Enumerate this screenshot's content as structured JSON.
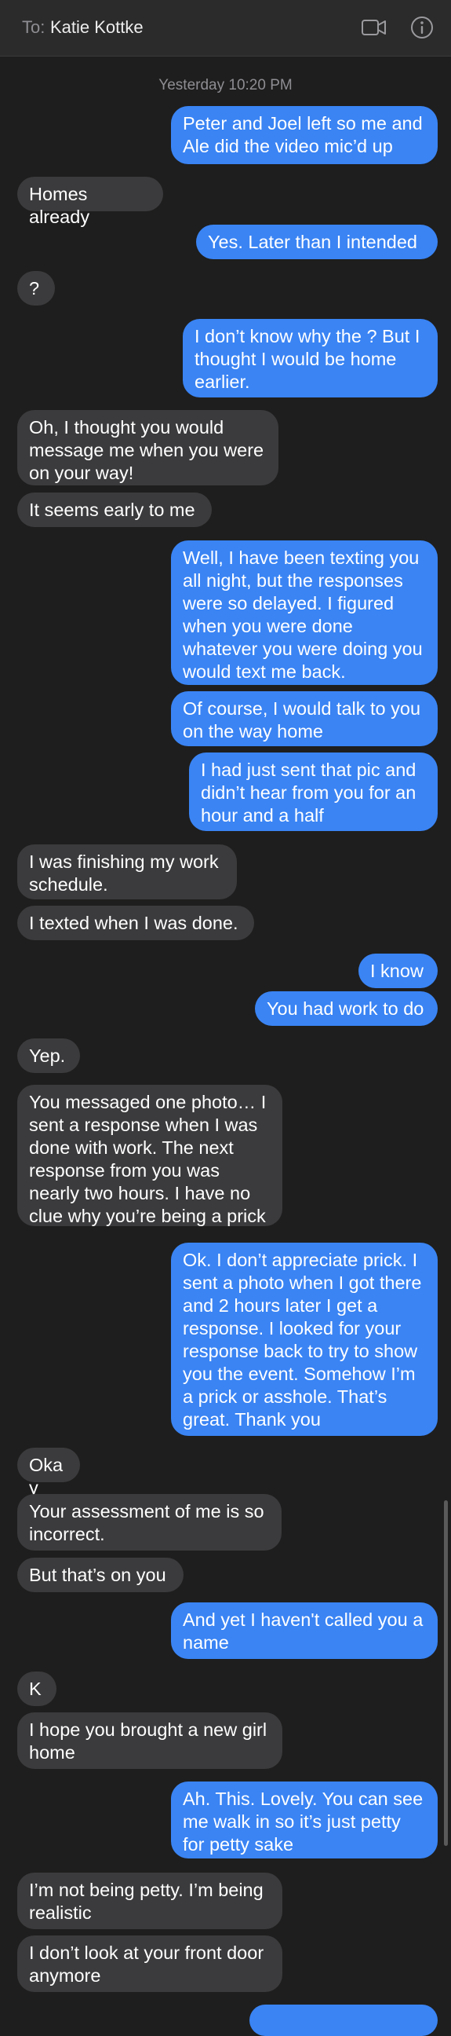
{
  "header": {
    "to_label": "To:",
    "contact_name": "Katie Kottke",
    "video_icon": "video-camera-icon",
    "info_icon": "info-circle-icon"
  },
  "conversation": {
    "timestamp": "Yesterday 10:20 PM",
    "messages": [
      {
        "dir": "out",
        "text": "Peter and Joel left so me and Ale did the video mic’d up"
      },
      {
        "dir": "in",
        "text": "Homes already"
      },
      {
        "dir": "out",
        "text": "Yes. Later than I intended"
      },
      {
        "dir": "in",
        "text": "?"
      },
      {
        "dir": "out",
        "text": "I don’t know why the ? But I thought I would be home earlier."
      },
      {
        "dir": "in",
        "text": "Oh, I thought you would message me when you were on your way!"
      },
      {
        "dir": "in",
        "text": "It seems early to me"
      },
      {
        "dir": "out",
        "text": "Well, I have been texting you all night, but the responses were so delayed. I figured when you were done whatever you were doing you would text me back."
      },
      {
        "dir": "out",
        "text": "Of course, I would talk to you on the way home"
      },
      {
        "dir": "out",
        "text": "I had just sent that pic and didn’t hear from you for an hour and a half"
      },
      {
        "dir": "in",
        "text": "I was finishing my work schedule."
      },
      {
        "dir": "in",
        "text": "I texted when I was done."
      },
      {
        "dir": "out",
        "text": "I know"
      },
      {
        "dir": "out",
        "text": "You had work to do"
      },
      {
        "dir": "in",
        "text": "Yep."
      },
      {
        "dir": "in",
        "text": "You messaged one photo… I sent a response when I was done with work. The next response from you was nearly two hours. I have no clue why you’re being a prick"
      },
      {
        "dir": "out",
        "text": "Ok. I don’t appreciate prick. I sent a photo when I got there and 2 hours later I get a response. I looked for your response back to try to show you the event. Somehow I’m a prick or asshole. That’s great. Thank you"
      },
      {
        "dir": "in",
        "text": "Okay"
      },
      {
        "dir": "in",
        "text": "Your assessment of me is so incorrect."
      },
      {
        "dir": "in",
        "text": "But that’s on you"
      },
      {
        "dir": "out",
        "text": "And yet I haven't called you a name"
      },
      {
        "dir": "in",
        "text": "K"
      },
      {
        "dir": "in",
        "text": "I hope you brought a new girl home"
      },
      {
        "dir": "out",
        "text": "Ah. This. Lovely. You can see me walk in so it’s just petty for petty sake"
      },
      {
        "dir": "in",
        "text": "I’m not being petty. I’m being realistic"
      },
      {
        "dir": "in",
        "text": "I don’t look at your front door anymore"
      },
      {
        "dir": "out",
        "text": ""
      }
    ]
  }
}
